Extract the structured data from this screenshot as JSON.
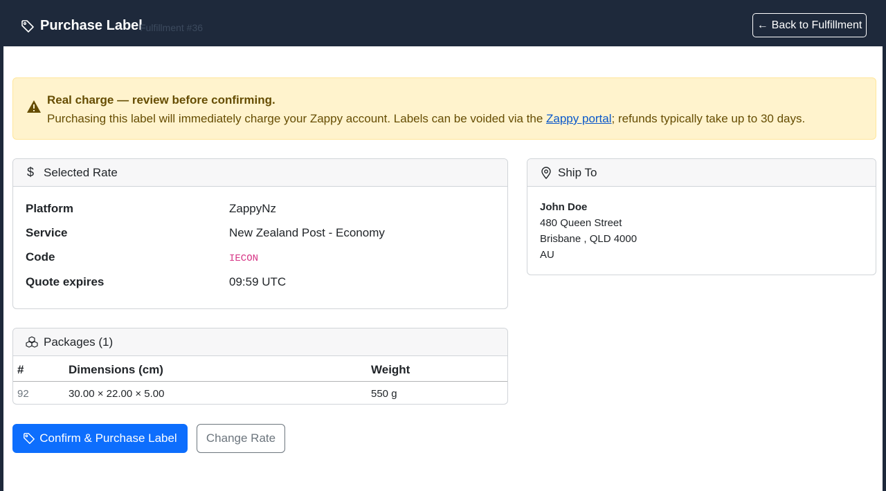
{
  "header": {
    "title": "Purchase Label",
    "subtitle": "Fulfillment #36",
    "back_label": "Back to Fulfillment",
    "icon": "tag-icon"
  },
  "alert": {
    "title": "Real charge — review before confirming.",
    "body_prefix": "Purchasing this label will immediately charge your Zappy account. Labels can be voided via the ",
    "link_text": "Zappy portal",
    "body_suffix": "; refunds typically take up to 30 days.",
    "icon": "warning-triangle-icon"
  },
  "selected_rate": {
    "title": "Selected Rate",
    "icon": "dollar-icon",
    "rows": [
      {
        "key": "Platform",
        "value": "ZappyNz"
      },
      {
        "key": "Service",
        "value": "New Zealand Post - Economy"
      },
      {
        "key": "Code",
        "value": "IECON"
      },
      {
        "key": "Quote expires",
        "value": "09:59 UTC"
      }
    ]
  },
  "ship_to": {
    "title": "Ship To",
    "icon": "map-pin-icon",
    "name": "John Doe",
    "street": "480 Queen Street",
    "city_line": "Brisbane , QLD 4000",
    "country": "AU"
  },
  "packages": {
    "title": "Packages (1)",
    "icon": "boxes-icon",
    "columns": [
      "#",
      "Dimensions (cm)",
      "Weight"
    ],
    "rows": [
      {
        "id": "92",
        "dimensions": "30.00 × 22.00 × 5.00",
        "weight": "550 g"
      }
    ]
  },
  "actions": {
    "confirm_label": "Confirm & Purchase Label",
    "change_label": "Change Rate"
  },
  "colors": {
    "header_bg": "#1e293b",
    "primary": "#0d6efd",
    "alert_bg": "#fff3cd",
    "alert_text": "#664d03",
    "code_pink": "#d63384"
  }
}
